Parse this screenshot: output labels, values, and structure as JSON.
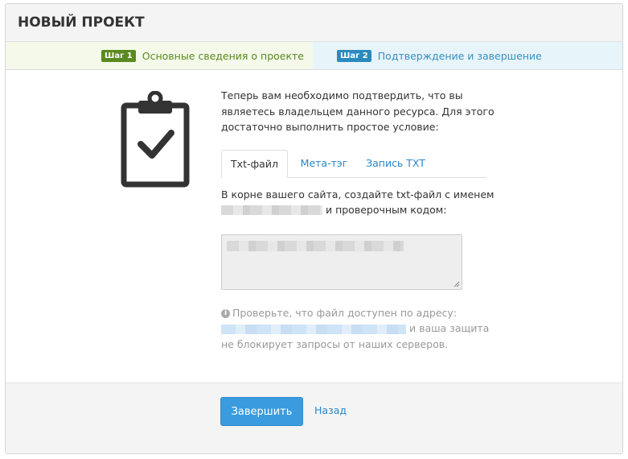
{
  "header": {
    "title": "НОВЫЙ ПРОЕКТ"
  },
  "steps": [
    {
      "badge": "Шаг 1",
      "label": "Основные сведения о проекте",
      "color": "#5a8a1f"
    },
    {
      "badge": "Шаг 2",
      "label": "Подтверждение и завершение",
      "color": "#2a8bbd"
    }
  ],
  "main": {
    "icon": "clipboard-check-icon",
    "intro": "Теперь вам необходимо подтвердить, что вы являетесь владельцем данного ресурса. Для этого достаточно выполнить простое условие:",
    "tabs": [
      {
        "label": "Txt-файл",
        "active": true
      },
      {
        "label": "Мета-тэг",
        "active": false
      },
      {
        "label": "Запись TXT",
        "active": false
      }
    ],
    "instruction_before": "В корне вашего сайта, создайте txt-файл с именем",
    "instruction_after": " и проверочным кодом:",
    "note_line1": "Проверьте, что файл доступен по адресу:",
    "note_after_link": " и ваша защита",
    "note_line3": "не блокирует запросы от наших серверов."
  },
  "footer": {
    "finish_label": "Завершить",
    "back_label": "Назад",
    "primary_color": "#3a9bde"
  }
}
